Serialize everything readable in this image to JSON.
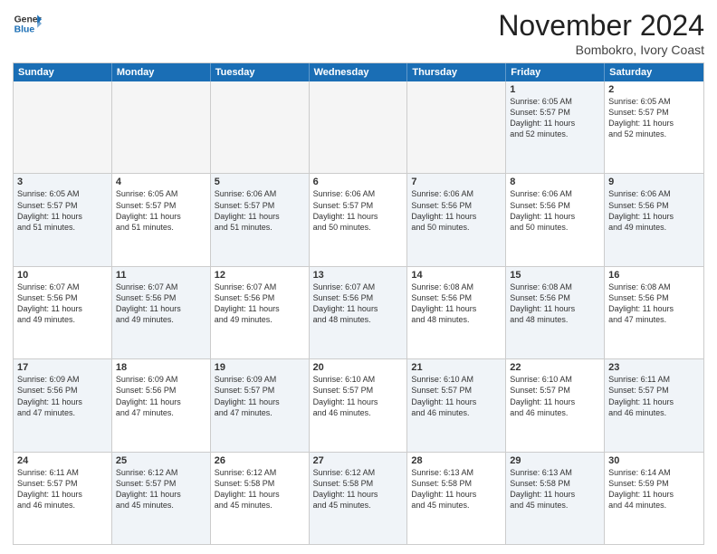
{
  "header": {
    "logo_line1": "General",
    "logo_line2": "Blue",
    "month": "November 2024",
    "location": "Bombokro, Ivory Coast"
  },
  "weekdays": [
    "Sunday",
    "Monday",
    "Tuesday",
    "Wednesday",
    "Thursday",
    "Friday",
    "Saturday"
  ],
  "weeks": [
    [
      {
        "day": "",
        "info": "",
        "empty": true
      },
      {
        "day": "",
        "info": "",
        "empty": true
      },
      {
        "day": "",
        "info": "",
        "empty": true
      },
      {
        "day": "",
        "info": "",
        "empty": true
      },
      {
        "day": "",
        "info": "",
        "empty": true
      },
      {
        "day": "1",
        "info": "Sunrise: 6:05 AM\nSunset: 5:57 PM\nDaylight: 11 hours\nand 52 minutes.",
        "alt": true
      },
      {
        "day": "2",
        "info": "Sunrise: 6:05 AM\nSunset: 5:57 PM\nDaylight: 11 hours\nand 52 minutes.",
        "alt": false
      }
    ],
    [
      {
        "day": "3",
        "info": "Sunrise: 6:05 AM\nSunset: 5:57 PM\nDaylight: 11 hours\nand 51 minutes.",
        "alt": true
      },
      {
        "day": "4",
        "info": "Sunrise: 6:05 AM\nSunset: 5:57 PM\nDaylight: 11 hours\nand 51 minutes.",
        "alt": false
      },
      {
        "day": "5",
        "info": "Sunrise: 6:06 AM\nSunset: 5:57 PM\nDaylight: 11 hours\nand 51 minutes.",
        "alt": true
      },
      {
        "day": "6",
        "info": "Sunrise: 6:06 AM\nSunset: 5:57 PM\nDaylight: 11 hours\nand 50 minutes.",
        "alt": false
      },
      {
        "day": "7",
        "info": "Sunrise: 6:06 AM\nSunset: 5:56 PM\nDaylight: 11 hours\nand 50 minutes.",
        "alt": true
      },
      {
        "day": "8",
        "info": "Sunrise: 6:06 AM\nSunset: 5:56 PM\nDaylight: 11 hours\nand 50 minutes.",
        "alt": false
      },
      {
        "day": "9",
        "info": "Sunrise: 6:06 AM\nSunset: 5:56 PM\nDaylight: 11 hours\nand 49 minutes.",
        "alt": true
      }
    ],
    [
      {
        "day": "10",
        "info": "Sunrise: 6:07 AM\nSunset: 5:56 PM\nDaylight: 11 hours\nand 49 minutes.",
        "alt": false
      },
      {
        "day": "11",
        "info": "Sunrise: 6:07 AM\nSunset: 5:56 PM\nDaylight: 11 hours\nand 49 minutes.",
        "alt": true
      },
      {
        "day": "12",
        "info": "Sunrise: 6:07 AM\nSunset: 5:56 PM\nDaylight: 11 hours\nand 49 minutes.",
        "alt": false
      },
      {
        "day": "13",
        "info": "Sunrise: 6:07 AM\nSunset: 5:56 PM\nDaylight: 11 hours\nand 48 minutes.",
        "alt": true
      },
      {
        "day": "14",
        "info": "Sunrise: 6:08 AM\nSunset: 5:56 PM\nDaylight: 11 hours\nand 48 minutes.",
        "alt": false
      },
      {
        "day": "15",
        "info": "Sunrise: 6:08 AM\nSunset: 5:56 PM\nDaylight: 11 hours\nand 48 minutes.",
        "alt": true
      },
      {
        "day": "16",
        "info": "Sunrise: 6:08 AM\nSunset: 5:56 PM\nDaylight: 11 hours\nand 47 minutes.",
        "alt": false
      }
    ],
    [
      {
        "day": "17",
        "info": "Sunrise: 6:09 AM\nSunset: 5:56 PM\nDaylight: 11 hours\nand 47 minutes.",
        "alt": true
      },
      {
        "day": "18",
        "info": "Sunrise: 6:09 AM\nSunset: 5:56 PM\nDaylight: 11 hours\nand 47 minutes.",
        "alt": false
      },
      {
        "day": "19",
        "info": "Sunrise: 6:09 AM\nSunset: 5:57 PM\nDaylight: 11 hours\nand 47 minutes.",
        "alt": true
      },
      {
        "day": "20",
        "info": "Sunrise: 6:10 AM\nSunset: 5:57 PM\nDaylight: 11 hours\nand 46 minutes.",
        "alt": false
      },
      {
        "day": "21",
        "info": "Sunrise: 6:10 AM\nSunset: 5:57 PM\nDaylight: 11 hours\nand 46 minutes.",
        "alt": true
      },
      {
        "day": "22",
        "info": "Sunrise: 6:10 AM\nSunset: 5:57 PM\nDaylight: 11 hours\nand 46 minutes.",
        "alt": false
      },
      {
        "day": "23",
        "info": "Sunrise: 6:11 AM\nSunset: 5:57 PM\nDaylight: 11 hours\nand 46 minutes.",
        "alt": true
      }
    ],
    [
      {
        "day": "24",
        "info": "Sunrise: 6:11 AM\nSunset: 5:57 PM\nDaylight: 11 hours\nand 46 minutes.",
        "alt": false
      },
      {
        "day": "25",
        "info": "Sunrise: 6:12 AM\nSunset: 5:57 PM\nDaylight: 11 hours\nand 45 minutes.",
        "alt": true
      },
      {
        "day": "26",
        "info": "Sunrise: 6:12 AM\nSunset: 5:58 PM\nDaylight: 11 hours\nand 45 minutes.",
        "alt": false
      },
      {
        "day": "27",
        "info": "Sunrise: 6:12 AM\nSunset: 5:58 PM\nDaylight: 11 hours\nand 45 minutes.",
        "alt": true
      },
      {
        "day": "28",
        "info": "Sunrise: 6:13 AM\nSunset: 5:58 PM\nDaylight: 11 hours\nand 45 minutes.",
        "alt": false
      },
      {
        "day": "29",
        "info": "Sunrise: 6:13 AM\nSunset: 5:58 PM\nDaylight: 11 hours\nand 45 minutes.",
        "alt": true
      },
      {
        "day": "30",
        "info": "Sunrise: 6:14 AM\nSunset: 5:59 PM\nDaylight: 11 hours\nand 44 minutes.",
        "alt": false
      }
    ]
  ]
}
